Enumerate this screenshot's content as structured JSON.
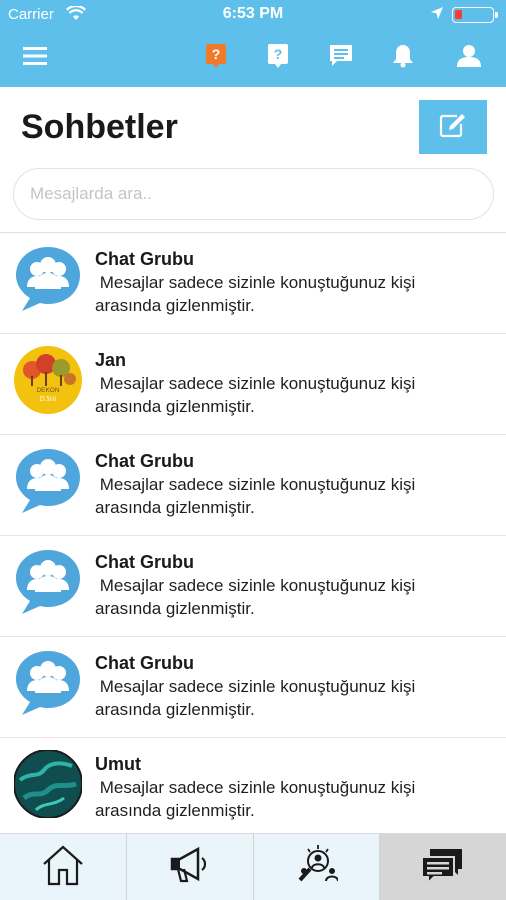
{
  "status_bar": {
    "carrier": "Carrier",
    "time": "6:53 PM",
    "battery_level": 0.2,
    "wifi_icon": "wifi-icon",
    "location_icon": "location-arrow-icon"
  },
  "nav": {
    "icons": [
      "menu-icon",
      "help-orange-icon",
      "help-icon",
      "chat-icon",
      "bell-icon",
      "user-icon"
    ],
    "accent": "#5ec0ea",
    "highlight": "#f07a2a"
  },
  "page": {
    "title": "Sohbetler",
    "compose_icon": "compose-icon"
  },
  "search": {
    "placeholder": "Mesajlarda ara.."
  },
  "conversations": [
    {
      "name": "Chat Grubu",
      "message": " Mesajlar sadece sizinle konuştuğunuz kişi arasında gizlenmiştir.",
      "avatar": "group-chat-icon"
    },
    {
      "name": "Jan",
      "message": " Mesajlar sadece sizinle konuştuğunuz kişi arasında gizlenmiştir.",
      "avatar": "profile-photo",
      "avatar_text": [
        "DEKON",
        "D.Yeli"
      ]
    },
    {
      "name": "Chat Grubu",
      "message": " Mesajlar sadece sizinle konuştuğunuz kişi arasında gizlenmiştir.",
      "avatar": "group-chat-icon"
    },
    {
      "name": "Chat Grubu",
      "message": " Mesajlar sadece sizinle konuştuğunuz kişi arasında gizlenmiştir.",
      "avatar": "group-chat-icon"
    },
    {
      "name": "Chat Grubu",
      "message": " Mesajlar sadece sizinle konuştuğunuz kişi arasında gizlenmiştir.",
      "avatar": "group-chat-icon"
    },
    {
      "name": "Umut",
      "message": " Mesajlar sadece sizinle konuştuğunuz kişi arasında gizlenmiştir.",
      "avatar": "profile-photo"
    }
  ],
  "tabbar": {
    "tabs": [
      "home-icon",
      "megaphone-icon",
      "people-search-icon",
      "chat-bubbles-icon"
    ],
    "active_index": 3
  }
}
